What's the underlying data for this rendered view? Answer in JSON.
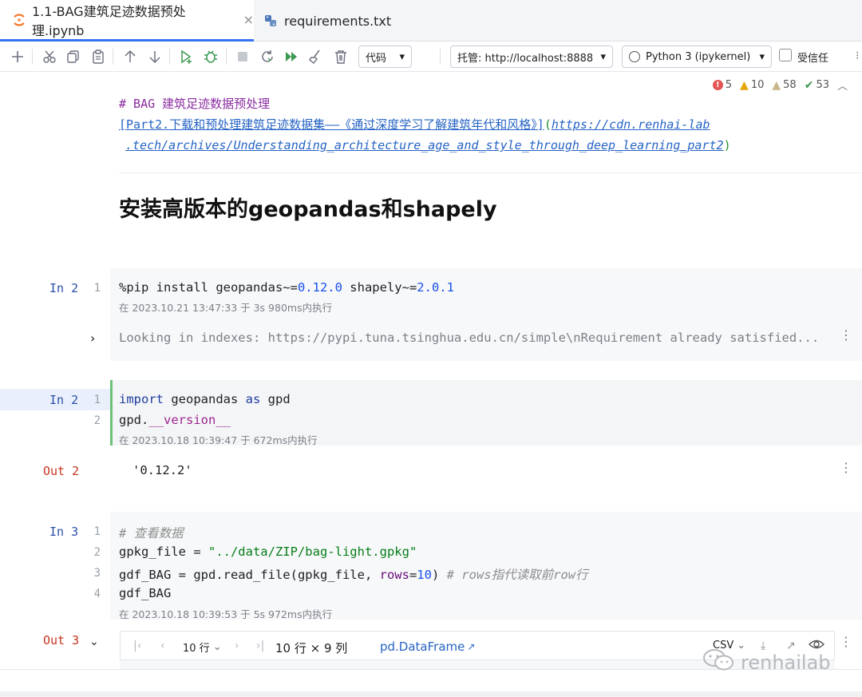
{
  "tabs": [
    {
      "label": "1.1-BAG建筑足迹数据预处理.ipynb",
      "close": "×"
    },
    {
      "label": "requirements.txt"
    }
  ],
  "toolbar": {
    "cell_type": "代码",
    "server": "托管: http://localhost:8888",
    "kernel": "Python 3 (ipykernel)",
    "trusted": "受信任"
  },
  "status": {
    "errors": "5",
    "warnings": "10",
    "weak_warnings": "58",
    "ok": "53"
  },
  "markdown": {
    "heading_comment": "# BAG 建筑足迹数据预处理",
    "link_text": "[Part2.下载和预处理建筑足迹数据集——《通过深度学习了解建筑年代和风格》]",
    "link_url_open": "(",
    "link_url_1": "https://cdn.renhai-lab",
    "link_url_2": ".tech/archives/Understanding_architecture_age_and_style_through_deep_learning_part2",
    "link_url_close": ")",
    "h1": "安装高版本的geopandas和shapely"
  },
  "cells": [
    {
      "label": "In 2",
      "meta": "在 2023.10.21 13:47:33 于 3s 980ms内执行",
      "line1": {
        "prefix": "%pip install geopandas~=",
        "v1": "0.12.0",
        "mid": " shapely~=",
        "v2": "2.0.1"
      },
      "output": "Looking in indexes: https://pypi.tuna.tsinghua.edu.cn/simple\\nRequirement already satisfied..."
    },
    {
      "label": "In 2",
      "meta": "在 2023.10.18 10:39:47 于 672ms内执行",
      "line1": {
        "kw": "import",
        "a": " geopandas ",
        "kw2": "as",
        "b": " gpd"
      },
      "line2": {
        "a": "gpd.",
        "dunder": "__version__"
      },
      "out_label": "Out 2",
      "output": "'0.12.2'"
    },
    {
      "label": "In 3",
      "meta": "在 2023.10.18 10:39:53 于 5s 972ms内执行",
      "line1": "# 查看数据",
      "line2": {
        "a": "gpkg_file = ",
        "str": "\"../data/ZIP/bag-light.gpkg\""
      },
      "line3": {
        "a": "gdf_BAG = gpd.read_file(gpkg_file, ",
        "param": "rows",
        "eq": "=",
        "num": "10",
        "close": ") ",
        "comment": "# rows指代读取前row行"
      },
      "line4": "gdf_BAG",
      "out_label": "Out 3"
    }
  ],
  "line_numbers": [
    "1",
    "2",
    "3",
    "4"
  ],
  "dataframe": {
    "page_size": "10 行",
    "shape": "10 行 × 9 列",
    "type_link": "pd.DataFrame",
    "export": "CSV"
  },
  "watermark": "renhailab"
}
